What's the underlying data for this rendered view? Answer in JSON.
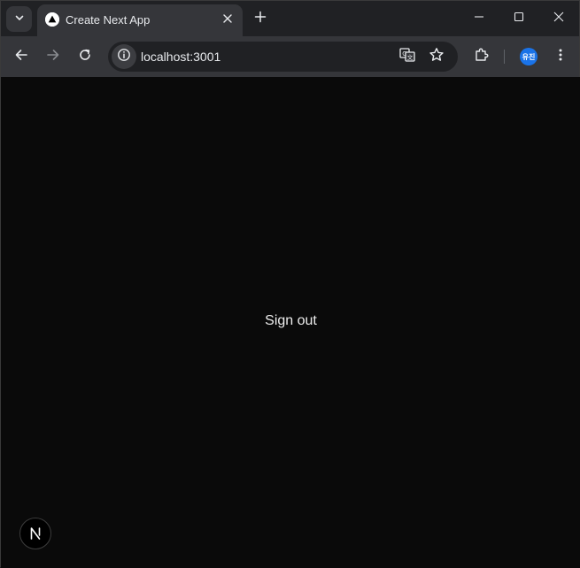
{
  "tab": {
    "title": "Create Next App"
  },
  "address_bar": {
    "url": "localhost:3001"
  },
  "profile": {
    "initials": "유진",
    "color": "#1a73e8"
  },
  "page": {
    "signout_label": "Sign out",
    "next_badge_label": "N"
  },
  "icons": {
    "tab_search": "chevron-down-icon",
    "favicon": "triangle-icon",
    "tab_close": "close-icon",
    "new_tab": "plus-icon",
    "minimize": "minimize-icon",
    "maximize": "maximize-icon",
    "close_window": "close-icon",
    "back": "arrow-left-icon",
    "forward": "arrow-right-icon",
    "reload": "reload-icon",
    "site_info": "info-icon",
    "translate": "translate-icon",
    "bookmark": "star-icon",
    "extensions": "puzzle-icon",
    "menu": "kebab-menu-icon"
  },
  "colors": {
    "frame": "#202124",
    "toolbar": "#35363a",
    "page_background": "#0a0a0a",
    "text": "#ededed"
  }
}
